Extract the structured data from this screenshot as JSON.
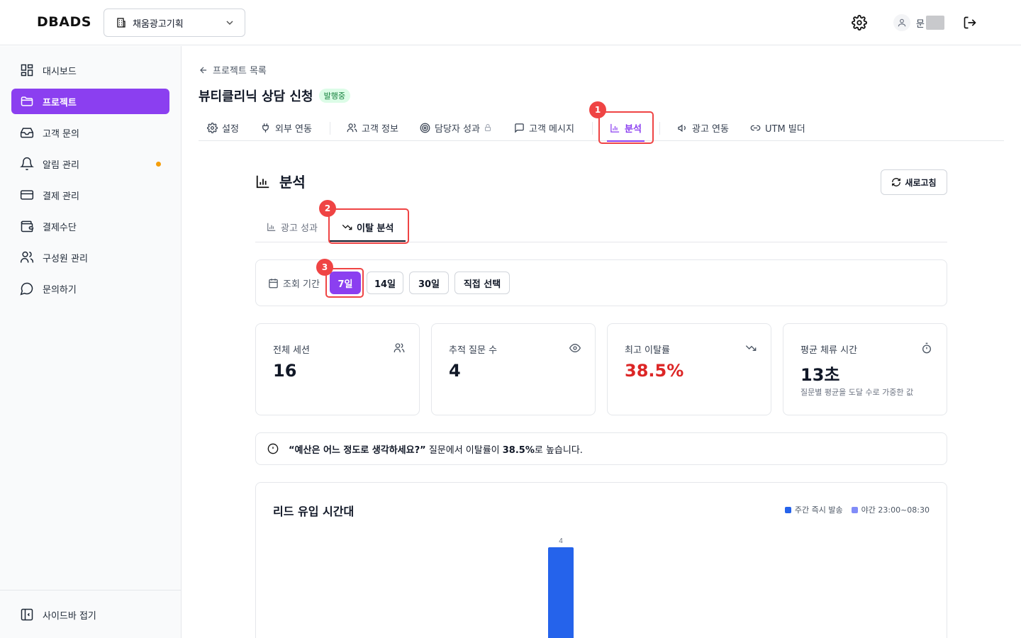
{
  "header": {
    "logo": "DBADS",
    "org_select": "채움광고기획",
    "user_name": "문"
  },
  "sidebar": {
    "items": [
      {
        "label": "대시보드",
        "icon": "dashboard-icon"
      },
      {
        "label": "프로젝트",
        "icon": "folder-icon",
        "active": true
      },
      {
        "label": "고객 문의",
        "icon": "inbox-icon"
      },
      {
        "label": "알림 관리",
        "icon": "bell-icon",
        "dot": true
      },
      {
        "label": "결제 관리",
        "icon": "credit-card-icon"
      },
      {
        "label": "결제수단",
        "icon": "wallet-icon"
      },
      {
        "label": "구성원 관리",
        "icon": "users-icon"
      },
      {
        "label": "문의하기",
        "icon": "chat-icon"
      }
    ],
    "collapse_label": "사이드바 접기"
  },
  "project": {
    "back_label": "프로젝트 목록",
    "title": "뷰티클리닉 상담 신청",
    "status": "발행중"
  },
  "tabs": [
    {
      "label": "설정",
      "icon": "gear-icon"
    },
    {
      "label": "외부 연동",
      "icon": "plug-icon"
    },
    {
      "label": "고객 정보",
      "icon": "users-icon"
    },
    {
      "label": "담당자 성과",
      "icon": "target-icon"
    },
    {
      "label": "고객 메시지",
      "icon": "message-icon"
    },
    {
      "label": "분석",
      "icon": "bar-chart-icon",
      "active": true
    },
    {
      "label": "광고 연동",
      "icon": "megaphone-icon"
    },
    {
      "label": "UTM 빌더",
      "icon": "link-icon"
    }
  ],
  "annotations": [
    "1",
    "2",
    "3"
  ],
  "analysis": {
    "title": "분석",
    "refresh_label": "새로고침",
    "subtabs": [
      {
        "label": "광고 성과"
      },
      {
        "label": "이탈 분석",
        "active": true
      }
    ],
    "period": {
      "label": "조회 기간",
      "options": [
        "7일",
        "14일",
        "30일",
        "직접 선택"
      ],
      "selected": "7일"
    },
    "stats": [
      {
        "label": "전체 세션",
        "value": "16",
        "icon": "users-icon"
      },
      {
        "label": "추적 질문 수",
        "value": "4",
        "icon": "eye-icon"
      },
      {
        "label": "최고 이탈률",
        "value": "38.5%",
        "icon": "trending-down-icon",
        "highlight": "#dc2626"
      },
      {
        "label": "평균 체류 시간",
        "value": "13초",
        "icon": "timer-icon",
        "note": "질문별 평균을 도달 수로 가중한 값"
      }
    ],
    "alert": {
      "question": "“예산은 어느 정도로 생각하세요?”",
      "mid_text": " 질문에서 이탈률이 ",
      "rate": "38.5%",
      "end_text": "로 높습니다."
    }
  },
  "chart_data": {
    "type": "bar",
    "title": "리드 유입 시간대",
    "series": [
      {
        "name": "주간 즉시 발송",
        "color": "#2563eb"
      },
      {
        "name": "야간 23:00~08:30",
        "color": "#818cf8"
      }
    ],
    "categories": [],
    "visible_bars": [
      {
        "series": "주간 즉시 발송",
        "value": 4
      }
    ],
    "ylim": [
      0,
      4
    ]
  }
}
